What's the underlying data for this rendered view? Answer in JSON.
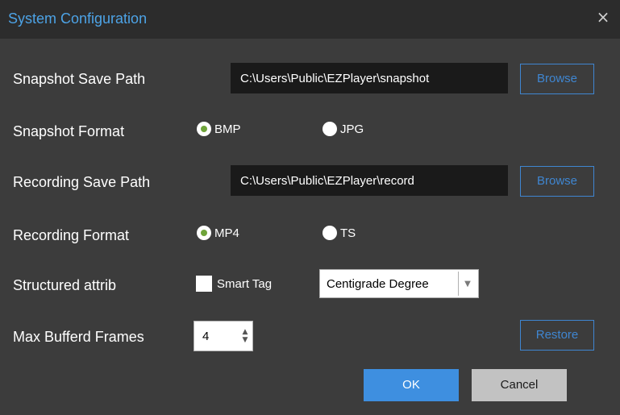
{
  "dialog": {
    "title": "System Configuration",
    "close_symbol": "×"
  },
  "snapshot_path": {
    "label": "Snapshot Save Path",
    "value": "C:\\Users\\Public\\EZPlayer\\snapshot",
    "browse_label": "Browse"
  },
  "snapshot_format": {
    "label": "Snapshot Format",
    "options": [
      {
        "label": "BMP",
        "selected": true
      },
      {
        "label": "JPG",
        "selected": false
      }
    ]
  },
  "recording_path": {
    "label": "Recording Save Path",
    "value": "C:\\Users\\Public\\EZPlayer\\record",
    "browse_label": "Browse"
  },
  "recording_format": {
    "label": "Recording Format",
    "options": [
      {
        "label": "MP4",
        "selected": true
      },
      {
        "label": "TS",
        "selected": false
      }
    ]
  },
  "structured_attrib": {
    "label": "Structured attrib",
    "smart_tag_label": "Smart Tag",
    "smart_tag_checked": false,
    "unit_selected": "Centigrade Degree"
  },
  "max_buffered_frames": {
    "label": "Max Bufferd Frames",
    "value": "4",
    "restore_label": "Restore"
  },
  "footer": {
    "ok_label": "OK",
    "cancel_label": "Cancel"
  },
  "colors": {
    "accent": "#3f86d1",
    "ok_button": "#3e8fe0",
    "radio_selected": "#6fa43a",
    "background": "#3c3c3c",
    "titlebar": "#2c2c2c"
  }
}
